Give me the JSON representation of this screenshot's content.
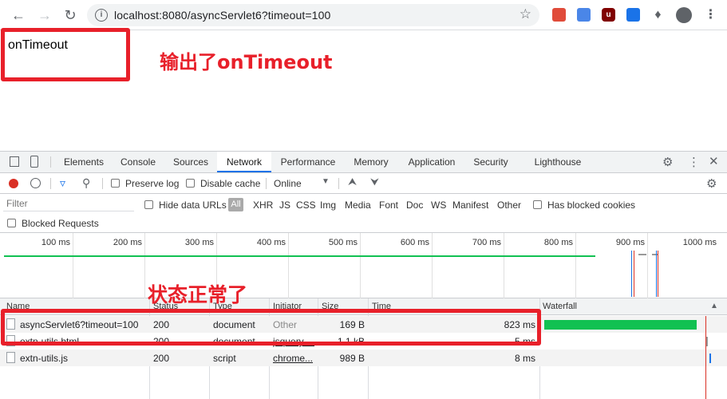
{
  "browser": {
    "url": "localhost:8080/asyncServlet6?timeout=100",
    "icons": [
      "back-icon",
      "forward-icon",
      "reload-icon",
      "info-icon",
      "star-icon"
    ]
  },
  "page": {
    "output_text": "onTimeout",
    "annotation_top": "输出了onTimeout",
    "annotation_mid": "状态正常了"
  },
  "devtools": {
    "tabs": [
      "Elements",
      "Console",
      "Sources",
      "Network",
      "Performance",
      "Memory",
      "Application",
      "Security",
      "Lighthouse"
    ],
    "active_tab": "Network",
    "toolbar": {
      "preserve_log": "Preserve log",
      "disable_cache": "Disable cache",
      "throttle": "Online"
    },
    "filter": {
      "placeholder": "Filter",
      "hide_data_urls": "Hide data URLs",
      "types": [
        "All",
        "XHR",
        "JS",
        "CSS",
        "Img",
        "Media",
        "Font",
        "Doc",
        "WS",
        "Manifest",
        "Other"
      ],
      "has_blocked_cookies": "Has blocked cookies",
      "blocked_requests": "Blocked Requests"
    },
    "timeline_ticks": [
      "100 ms",
      "200 ms",
      "300 ms",
      "400 ms",
      "500 ms",
      "600 ms",
      "700 ms",
      "800 ms",
      "900 ms",
      "1000 ms"
    ],
    "columns": {
      "name": "Name",
      "status": "Status",
      "type": "Type",
      "initiator": "Initiator",
      "size": "Size",
      "time": "Time",
      "waterfall": "Waterfall"
    },
    "rows": [
      {
        "name": "asyncServlet6?timeout=100",
        "status": "200",
        "type": "document",
        "initiator": "Other",
        "size": "169 B",
        "time": "823 ms"
      },
      {
        "name": "extn-utils.html",
        "status": "200",
        "type": "document",
        "initiator": "jsquery-...",
        "size": "1.1 kB",
        "time": "5 ms"
      },
      {
        "name": "extn-utils.js",
        "status": "200",
        "type": "script",
        "initiator": "chrome...",
        "size": "989 B",
        "time": "8 ms"
      }
    ],
    "colors": {
      "waterfall_bar": "#11c152",
      "accent": "#1a73e8",
      "record": "#d93025"
    }
  }
}
